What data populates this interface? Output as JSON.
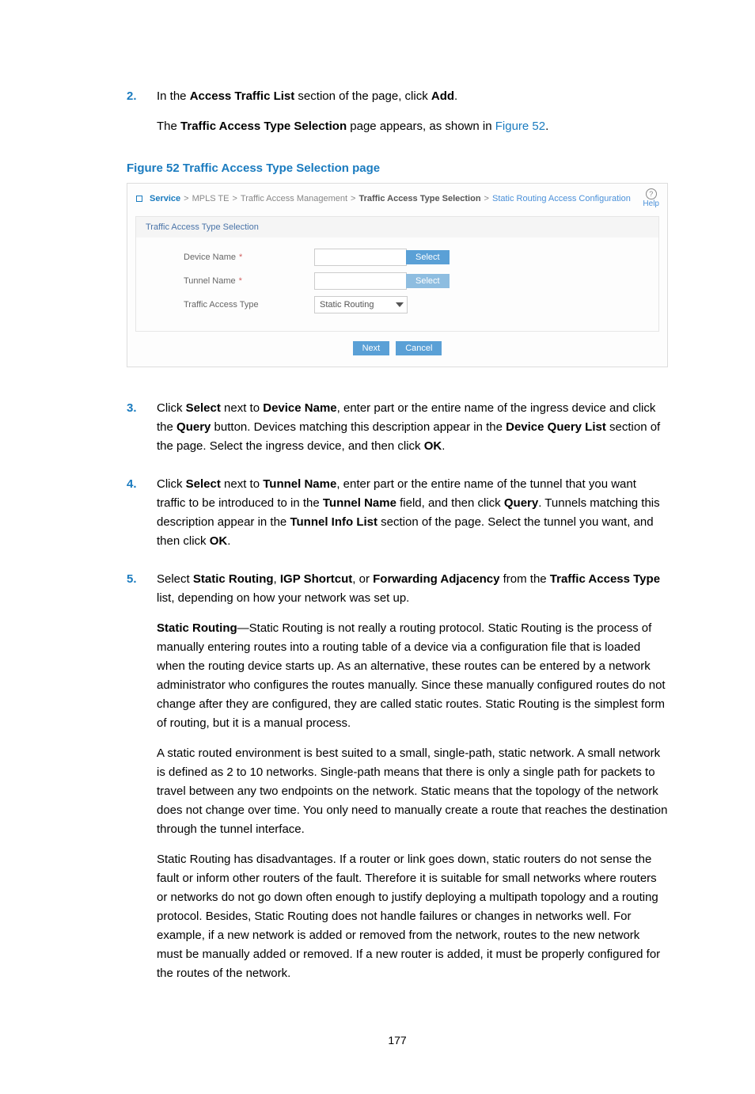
{
  "page_number": "177",
  "caption": "Figure 52 Traffic Access Type Selection page",
  "steps": {
    "s2": {
      "num": "2.",
      "p1_a": "In the ",
      "p1_b": "Access Traffic List",
      "p1_c": " section of the page, click ",
      "p1_d": "Add",
      "p1_e": ".",
      "p2_a": "The ",
      "p2_b": "Traffic Access Type Selection",
      "p2_c": " page appears, as shown in ",
      "p2_d": "Figure 52",
      "p2_e": "."
    },
    "s3": {
      "num": "3.",
      "a": "Click ",
      "b": "Select",
      "c": " next to ",
      "d": "Device Name",
      "e": ", enter part or the entire name of the ingress device and click the ",
      "f": "Query",
      "g": " button. Devices matching this description appear in the ",
      "h": "Device Query List",
      "i": " section of the page. Select the ingress device, and then click ",
      "j": "OK",
      "k": "."
    },
    "s4": {
      "num": "4.",
      "a": "Click ",
      "b": "Select",
      "c": " next to ",
      "d": "Tunnel Name",
      "e": ", enter part or the entire name of the tunnel that you want traffic to be introduced to in the ",
      "f": "Tunnel Name",
      "g": " field, and then click ",
      "h": "Query",
      "i": ". Tunnels matching this description appear in the ",
      "j": "Tunnel Info List",
      "k": " section of the page. Select the tunnel you want, and then click ",
      "l": "OK",
      "m": "."
    },
    "s5": {
      "num": "5.",
      "a": "Select ",
      "b": "Static Routing",
      "c": ", ",
      "d": "IGP Shortcut",
      "e": ", or ",
      "f": "Forwarding Adjacency",
      "g": " from the ",
      "h": "Traffic Access Type",
      "i": " list, depending on how your network was set up.",
      "p2_a": "Static Routing",
      "p2_b": "—Static Routing is not really a routing protocol. Static Routing is the process of manually entering routes into a routing table of a device via a configuration file that is loaded when the routing device starts up. As an alternative, these routes can be entered by a network administrator who configures the routes manually. Since these manually configured routes do not change after they are configured, they are called static routes. Static Routing is the simplest form of routing, but it is a manual process.",
      "p3": "A static routed environment is best suited to a small, single-path, static network. A small network is defined as 2 to 10 networks. Single-path means that there is only a single path for packets to travel between any two endpoints on the network. Static means that the topology of the network does not change over time. You only need to manually create a route that reaches the destination through the tunnel interface.",
      "p4": "Static Routing has disadvantages. If a router or link goes down, static routers do not sense the fault or inform other routers of the fault. Therefore it is suitable for small networks where routers or networks do not go down often enough to justify deploying a multipath topology and a routing protocol. Besides, Static Routing does not handle failures or changes in networks well. For example, if a new network is added or removed from the network, routes to the new network must be manually added or removed. If a new router is added, it must be properly configured for the routes of the network."
    }
  },
  "ui": {
    "bc": {
      "service": "Service",
      "mpls": "MPLS TE",
      "tam": "Traffic Access Management",
      "tats": "Traffic Access Type Selection",
      "srac": "Static Routing Access Configuration",
      "sep": ">"
    },
    "help": "Help",
    "section_title": "Traffic Access Type Selection",
    "device_label": "Device Name",
    "tunnel_label": "Tunnel Name",
    "type_label": "Traffic Access Type",
    "asterisk": "*",
    "select_btn": "Select",
    "type_value": "Static Routing",
    "next": "Next",
    "cancel": "Cancel"
  }
}
